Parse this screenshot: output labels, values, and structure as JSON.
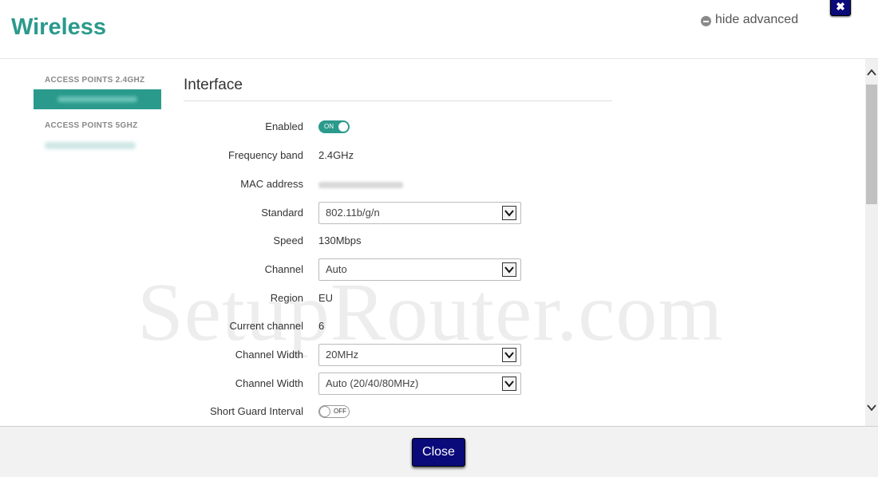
{
  "header": {
    "title": "Wireless",
    "hide_advanced": "hide advanced",
    "close_x": "✖"
  },
  "sidebar": {
    "heading_24": "ACCESS POINTS 2.4GHZ",
    "heading_5": "ACCESS POINTS 5GHZ"
  },
  "section": {
    "title": "Interface"
  },
  "fields": {
    "enabled": {
      "label": "Enabled",
      "toggle": "ON"
    },
    "frequency_band": {
      "label": "Frequency band",
      "value": "2.4GHz"
    },
    "mac_address": {
      "label": "MAC address"
    },
    "standard": {
      "label": "Standard",
      "value": "802.11b/g/n"
    },
    "speed": {
      "label": "Speed",
      "value": "130Mbps"
    },
    "channel": {
      "label": "Channel",
      "value": "Auto"
    },
    "region": {
      "label": "Region",
      "value": "EU"
    },
    "current_channel": {
      "label": "Current channel",
      "value": "6"
    },
    "channel_width_1": {
      "label": "Channel Width",
      "value": "20MHz"
    },
    "channel_width_2": {
      "label": "Channel Width",
      "value": "Auto (20/40/80MHz)"
    },
    "short_guard": {
      "label": "Short Guard Interval",
      "toggle": "OFF"
    }
  },
  "watermark": "SetupRouter.com",
  "footer": {
    "close_label": "Close"
  },
  "colors": {
    "accent": "#2a9a8c",
    "button": "#0a0a7a"
  }
}
